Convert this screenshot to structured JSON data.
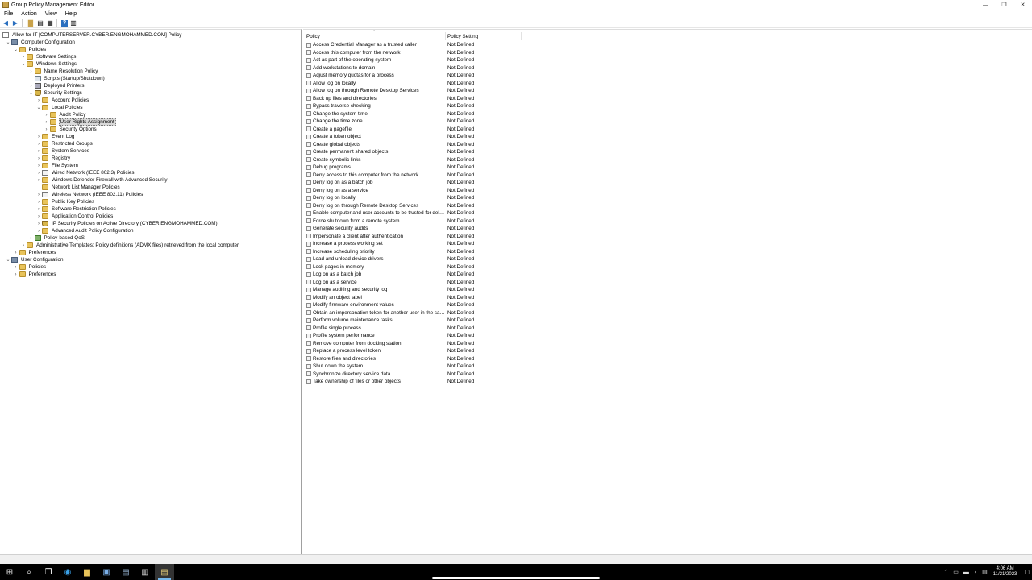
{
  "window": {
    "title": "Group Policy Management Editor",
    "controls": [
      "—",
      "❐",
      "✕"
    ]
  },
  "menu": [
    "File",
    "Action",
    "View",
    "Help"
  ],
  "tree": {
    "root": "Allow for IT [COMPUTERSERVER.CYBER.ENGMOHAMMED.COM] Policy",
    "items": [
      {
        "label": "Computer Configuration",
        "depth": 0,
        "exp": "⌄",
        "icon": "computer"
      },
      {
        "label": "Policies",
        "depth": 1,
        "exp": "⌄",
        "icon": "folder"
      },
      {
        "label": "Software Settings",
        "depth": 2,
        "exp": "›",
        "icon": "folder"
      },
      {
        "label": "Windows Settings",
        "depth": 2,
        "exp": "⌄",
        "icon": "folder"
      },
      {
        "label": "Name Resolution Policy",
        "depth": 3,
        "exp": "›",
        "icon": "folder"
      },
      {
        "label": "Scripts (Startup/Shutdown)",
        "depth": 3,
        "exp": "",
        "icon": "scripts"
      },
      {
        "label": "Deployed Printers",
        "depth": 3,
        "exp": "›",
        "icon": "printer"
      },
      {
        "label": "Security Settings",
        "depth": 3,
        "exp": "⌄",
        "icon": "shield"
      },
      {
        "label": "Account Policies",
        "depth": 4,
        "exp": "›",
        "icon": "folder"
      },
      {
        "label": "Local Policies",
        "depth": 4,
        "exp": "⌄",
        "icon": "folder"
      },
      {
        "label": "Audit Policy",
        "depth": 5,
        "exp": "›",
        "icon": "folder"
      },
      {
        "label": "User Rights Assignment",
        "depth": 5,
        "exp": "›",
        "icon": "folder",
        "selected": true
      },
      {
        "label": "Security Options",
        "depth": 5,
        "exp": "›",
        "icon": "folder"
      },
      {
        "label": "Event Log",
        "depth": 4,
        "exp": "›",
        "icon": "folder"
      },
      {
        "label": "Restricted Groups",
        "depth": 4,
        "exp": "›",
        "icon": "folder"
      },
      {
        "label": "System Services",
        "depth": 4,
        "exp": "›",
        "icon": "folder"
      },
      {
        "label": "Registry",
        "depth": 4,
        "exp": "›",
        "icon": "folder"
      },
      {
        "label": "File System",
        "depth": 4,
        "exp": "›",
        "icon": "folder"
      },
      {
        "label": "Wired Network (IEEE 802.3) Policies",
        "depth": 4,
        "exp": "›",
        "icon": "list"
      },
      {
        "label": "Windows Defender Firewall with Advanced Security",
        "depth": 4,
        "exp": "›",
        "icon": "folder"
      },
      {
        "label": "Network List Manager Policies",
        "depth": 4,
        "exp": "",
        "icon": "folder"
      },
      {
        "label": "Wireless Network (IEEE 802.11) Policies",
        "depth": 4,
        "exp": "›",
        "icon": "list"
      },
      {
        "label": "Public Key Policies",
        "depth": 4,
        "exp": "›",
        "icon": "folder"
      },
      {
        "label": "Software Restriction Policies",
        "depth": 4,
        "exp": "›",
        "icon": "folder"
      },
      {
        "label": "Application Control Policies",
        "depth": 4,
        "exp": "›",
        "icon": "folder"
      },
      {
        "label": "IP Security Policies on Active Directory (CYBER.ENGMOHAMMED.COM)",
        "depth": 4,
        "exp": "›",
        "icon": "shield"
      },
      {
        "label": "Advanced Audit Policy Configuration",
        "depth": 4,
        "exp": "›",
        "icon": "folder"
      },
      {
        "label": "Policy-based QoS",
        "depth": 3,
        "exp": "›",
        "icon": "chart"
      },
      {
        "label": "Administrative Templates: Policy definitions (ADMX files) retrieved from the local computer.",
        "depth": 2,
        "exp": "›",
        "icon": "folder"
      },
      {
        "label": "Preferences",
        "depth": 1,
        "exp": "›",
        "icon": "folder"
      },
      {
        "label": "User Configuration",
        "depth": 0,
        "exp": "⌄",
        "icon": "computer"
      },
      {
        "label": "Policies",
        "depth": 1,
        "exp": "›",
        "icon": "folder"
      },
      {
        "label": "Preferences",
        "depth": 1,
        "exp": "›",
        "icon": "folder"
      }
    ]
  },
  "list": {
    "col_policy": "Policy",
    "col_setting": "Policy Setting",
    "rows": [
      {
        "policy": "Access Credential Manager as a trusted caller",
        "setting": "Not Defined"
      },
      {
        "policy": "Access this computer from the network",
        "setting": "Not Defined"
      },
      {
        "policy": "Act as part of the operating system",
        "setting": "Not Defined"
      },
      {
        "policy": "Add workstations to domain",
        "setting": "Not Defined"
      },
      {
        "policy": "Adjust memory quotas for a process",
        "setting": "Not Defined"
      },
      {
        "policy": "Allow log on locally",
        "setting": "Not Defined"
      },
      {
        "policy": "Allow log on through Remote Desktop Services",
        "setting": "Not Defined"
      },
      {
        "policy": "Back up files and directories",
        "setting": "Not Defined"
      },
      {
        "policy": "Bypass traverse checking",
        "setting": "Not Defined"
      },
      {
        "policy": "Change the system time",
        "setting": "Not Defined"
      },
      {
        "policy": "Change the time zone",
        "setting": "Not Defined"
      },
      {
        "policy": "Create a pagefile",
        "setting": "Not Defined"
      },
      {
        "policy": "Create a token object",
        "setting": "Not Defined"
      },
      {
        "policy": "Create global objects",
        "setting": "Not Defined"
      },
      {
        "policy": "Create permanent shared objects",
        "setting": "Not Defined"
      },
      {
        "policy": "Create symbolic links",
        "setting": "Not Defined"
      },
      {
        "policy": "Debug programs",
        "setting": "Not Defined"
      },
      {
        "policy": "Deny access to this computer from the network",
        "setting": "Not Defined"
      },
      {
        "policy": "Deny log on as a batch job",
        "setting": "Not Defined"
      },
      {
        "policy": "Deny log on as a service",
        "setting": "Not Defined"
      },
      {
        "policy": "Deny log on locally",
        "setting": "Not Defined"
      },
      {
        "policy": "Deny log on through Remote Desktop Services",
        "setting": "Not Defined"
      },
      {
        "policy": "Enable computer and user accounts to be trusted for delega...",
        "setting": "Not Defined"
      },
      {
        "policy": "Force shutdown from a remote system",
        "setting": "Not Defined"
      },
      {
        "policy": "Generate security audits",
        "setting": "Not Defined"
      },
      {
        "policy": "Impersonate a client after authentication",
        "setting": "Not Defined"
      },
      {
        "policy": "Increase a process working set",
        "setting": "Not Defined"
      },
      {
        "policy": "Increase scheduling priority",
        "setting": "Not Defined"
      },
      {
        "policy": "Load and unload device drivers",
        "setting": "Not Defined"
      },
      {
        "policy": "Lock pages in memory",
        "setting": "Not Defined"
      },
      {
        "policy": "Log on as a batch job",
        "setting": "Not Defined"
      },
      {
        "policy": "Log on as a service",
        "setting": "Not Defined"
      },
      {
        "policy": "Manage auditing and security log",
        "setting": "Not Defined"
      },
      {
        "policy": "Modify an object label",
        "setting": "Not Defined"
      },
      {
        "policy": "Modify firmware environment values",
        "setting": "Not Defined"
      },
      {
        "policy": "Obtain an impersonation token for another user in the same...",
        "setting": "Not Defined"
      },
      {
        "policy": "Perform volume maintenance tasks",
        "setting": "Not Defined"
      },
      {
        "policy": "Profile single process",
        "setting": "Not Defined"
      },
      {
        "policy": "Profile system performance",
        "setting": "Not Defined"
      },
      {
        "policy": "Remove computer from docking station",
        "setting": "Not Defined"
      },
      {
        "policy": "Replace a process level token",
        "setting": "Not Defined"
      },
      {
        "policy": "Restore files and directories",
        "setting": "Not Defined"
      },
      {
        "policy": "Shut down the system",
        "setting": "Not Defined"
      },
      {
        "policy": "Synchronize directory service data",
        "setting": "Not Defined"
      },
      {
        "policy": "Take ownership of files or other objects",
        "setting": "Not Defined"
      }
    ]
  },
  "taskbar": {
    "time": "4:06 AM",
    "date": "11/21/2023"
  },
  "colors": {
    "accent": "#2a6fbf",
    "folder": "#e8c35a",
    "taskbar": "#000000"
  }
}
